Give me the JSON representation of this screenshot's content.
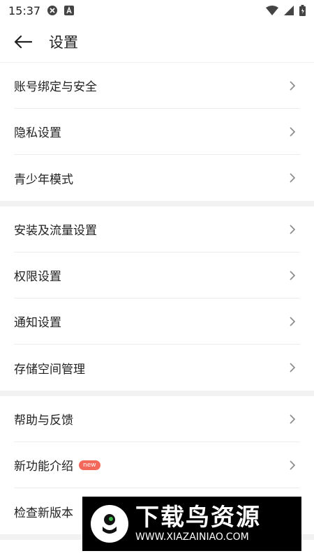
{
  "status": {
    "time": "15:37"
  },
  "header": {
    "title": "设置"
  },
  "groups": [
    {
      "items": [
        {
          "label": "账号绑定与安全"
        },
        {
          "label": "隐私设置"
        },
        {
          "label": "青少年模式"
        }
      ]
    },
    {
      "items": [
        {
          "label": "安装及流量设置"
        },
        {
          "label": "权限设置"
        },
        {
          "label": "通知设置"
        },
        {
          "label": "存储空间管理"
        }
      ]
    },
    {
      "items": [
        {
          "label": "帮助与反馈"
        },
        {
          "label": "新功能介绍",
          "badge": "new"
        },
        {
          "label": "检查新版本"
        }
      ]
    }
  ],
  "watermark": {
    "title": "下载鸟资源",
    "url": "WWW.XIAZAINIAO.COM"
  },
  "colors": {
    "badge": "#f2685a",
    "divider": "#ececec",
    "section_gap": "#f2f2f2"
  }
}
